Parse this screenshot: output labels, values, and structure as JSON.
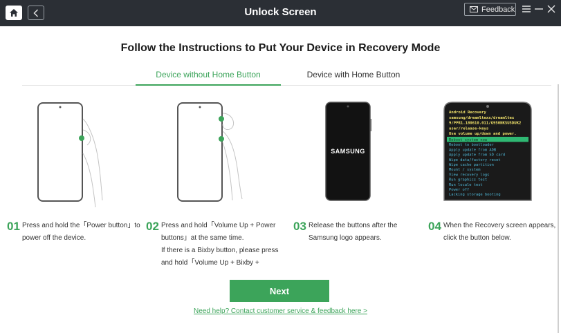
{
  "titlebar": {
    "title": "Unlock Screen",
    "feedback_label": "Feedback",
    "icons": [
      "home-icon",
      "back-icon",
      "mail-icon",
      "menu-icon",
      "minimize-icon",
      "close-icon"
    ]
  },
  "heading": "Follow the Instructions to Put Your Device in Recovery Mode",
  "tabs": [
    {
      "label": "Device without Home Button",
      "active": true
    },
    {
      "label": "Device with Home Button",
      "active": false
    }
  ],
  "steps": [
    {
      "number": "01",
      "lines": [
        "Press and hold the「Power button」to",
        "power off the device."
      ]
    },
    {
      "number": "02",
      "lines": [
        "Press and hold「Volume Up + Power",
        "buttons」at the same time.",
        "If there is a Bixby button, please press",
        "and hold「Volume Up + Bixby +"
      ]
    },
    {
      "number": "03",
      "lines": [
        "Release the buttons after the",
        "Samsung logo appears."
      ],
      "logo_text": "SAMSUNG"
    },
    {
      "number": "04",
      "lines": [
        "When the Recovery screen appears,",
        "click the button below."
      ]
    }
  ],
  "recovery_screen": {
    "header": [
      "Android Recovery",
      "samsung/dreamltexx/dreamltex",
      "9/PPR1.180610.011/G950NKSU5DUK2",
      "user/release-keys",
      "Use volume up/down and power."
    ],
    "menu": [
      "Reboot system now",
      "Reboot to bootloader",
      "Apply update from ADB",
      "Apply update from SD card",
      "Wipe data/factory reset",
      "Wipe cache partition",
      "Mount / system",
      "View recovery logs",
      "Run graphics test",
      "Run locale test",
      "Power off",
      "Lacking storage booting"
    ]
  },
  "next_label": "Next",
  "help_link": "Need help? Contact customer service & feedback here >",
  "colors": {
    "accent": "#3ca45a",
    "titlebar": "#2b2f35",
    "recovery_text": "#f2e36b",
    "recovery_menu": "#4fb8d8"
  }
}
